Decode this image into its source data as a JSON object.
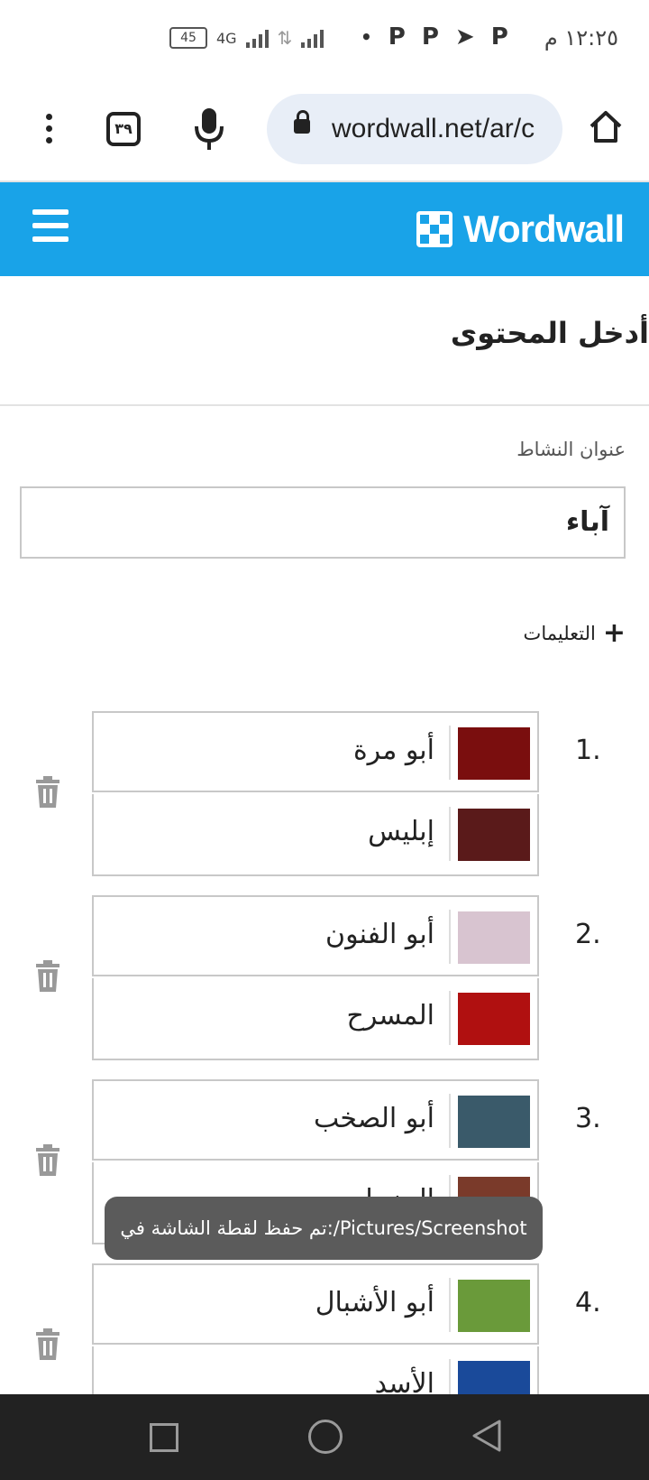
{
  "status": {
    "time": "١٢:٢٥ م",
    "battery": "45",
    "network": "4G",
    "app_icons": [
      "P",
      "P",
      "telegram",
      "P",
      "•"
    ]
  },
  "browser": {
    "url": "wordwall.net/ar/c",
    "tab_count": "٣٩",
    "icons": [
      "menu-dots-icon",
      "tabs-icon",
      "mic-icon",
      "lock-icon",
      "home-icon"
    ]
  },
  "header": {
    "logo_text": "Wordwall",
    "brand_color": "#19a3e8"
  },
  "page": {
    "heading": "أدخل المحتوى",
    "activity_title_label": "عنوان النشاط",
    "activity_title_value": "آباء",
    "instructions_label": "التعليمات"
  },
  "items": [
    {
      "num": "1.",
      "keyword": "أبو مرة",
      "match": "إبليس",
      "thumb1": "#7a0e0e",
      "thumb2": "#5a1a1a"
    },
    {
      "num": "2.",
      "keyword": "أبو الفنون",
      "match": "المسرح",
      "thumb1": "#d8c4d0",
      "thumb2": "#b01010"
    },
    {
      "num": "3.",
      "keyword": "أبو الصخب",
      "match": "المزمار",
      "thumb1": "#3a5a6a",
      "thumb2": "#7a3a2a"
    },
    {
      "num": "4.",
      "keyword": "أبو الأشبال",
      "match": "الأسد",
      "thumb1": "#6a9a3a",
      "thumb2": "#1a4a9a"
    }
  ],
  "toast": {
    "text": "تم حفظ لقطة الشاشة في:/Pictures/Screenshot"
  }
}
